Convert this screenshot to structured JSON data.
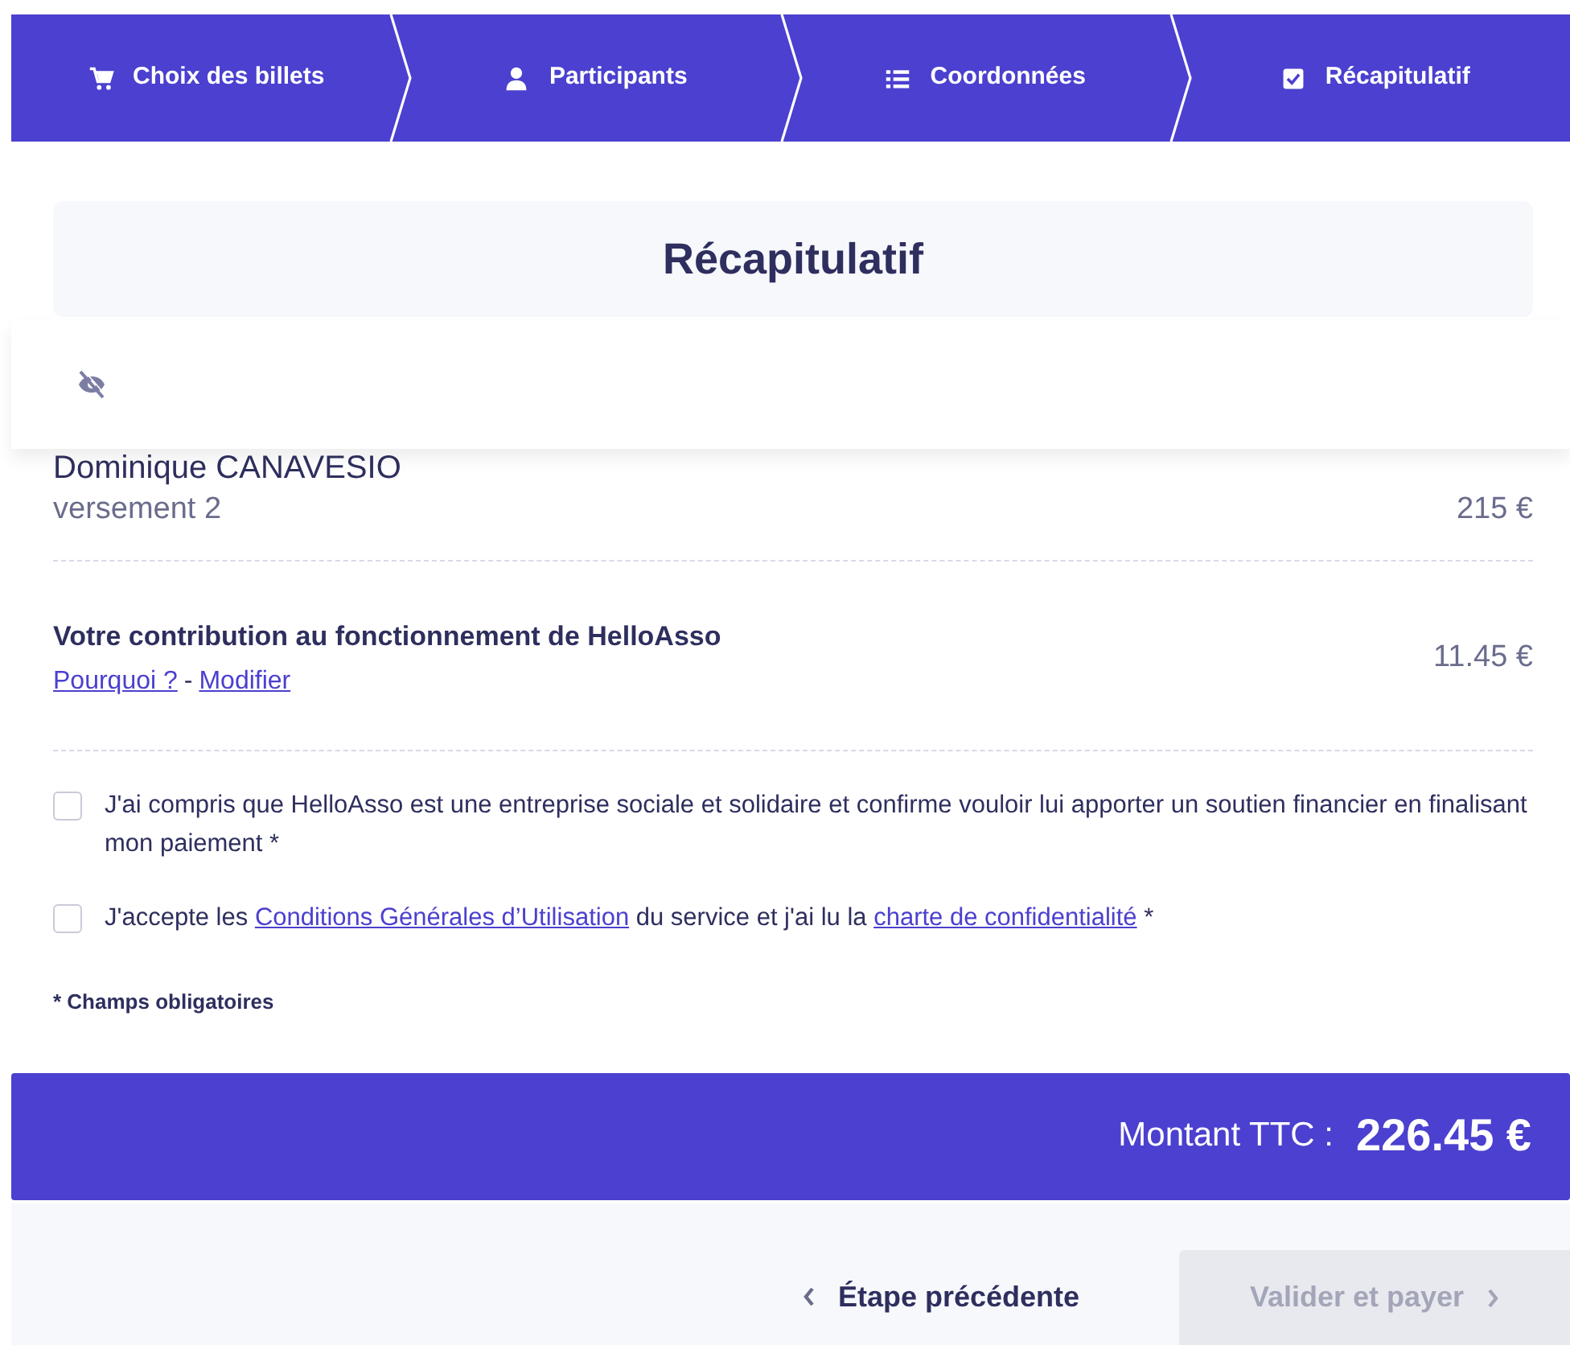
{
  "steps": [
    {
      "label": "Choix des billets"
    },
    {
      "label": "Participants"
    },
    {
      "label": "Coordonnées"
    },
    {
      "label": "Récapitulatif"
    }
  ],
  "title": "Récapitulatif",
  "items": [
    {
      "name": "Dominique CANAVESIO",
      "detail": "versement 2",
      "amount": "215 €"
    }
  ],
  "contribution": {
    "title": "Votre contribution au fonctionnement de HelloAsso",
    "links": [
      "Pourquoi ?",
      "Modifier"
    ],
    "separator": "-",
    "amount": "11.45 €"
  },
  "consents": [
    {
      "checked": false,
      "parts": [
        {
          "kind": "text",
          "text": "J'ai compris que HelloAsso est une entreprise sociale et solidaire et confirme vouloir lui apporter un soutien financier en finalisant mon paiement *"
        }
      ]
    },
    {
      "checked": false,
      "parts": [
        {
          "kind": "text",
          "text": "J'accepte les "
        },
        {
          "kind": "link",
          "text": "Conditions Générales d’Utilisation"
        },
        {
          "kind": "text",
          "text": " du service et j'ai lu la "
        },
        {
          "kind": "link",
          "text": "charte de confidentialité"
        },
        {
          "kind": "text",
          "text": " *"
        }
      ]
    }
  ],
  "required_note": "* Champs obligatoires",
  "total": {
    "label": "Montant TTC :",
    "amount": "226.45 €"
  },
  "buttons": [
    {
      "label": "Étape précédente",
      "kind": "back"
    },
    {
      "label": "Valider et payer",
      "kind": "next",
      "disabled": true
    }
  ]
}
